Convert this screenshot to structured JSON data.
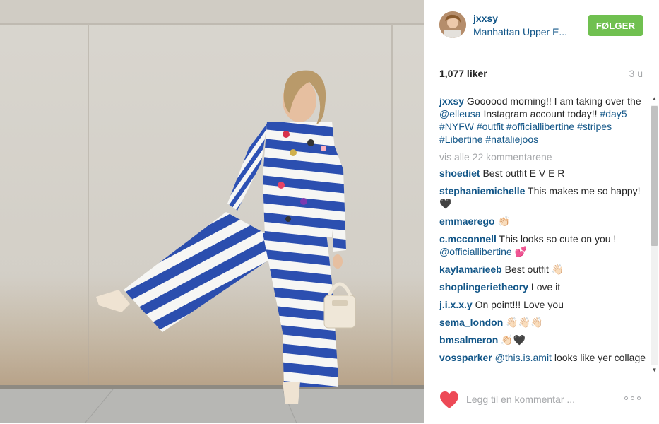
{
  "post": {
    "username": "jxxsy",
    "location": "Manhattan Upper E...",
    "follow_label": "FØLGER",
    "likes": "1,077 liker",
    "age": "3 u",
    "caption": {
      "user": "jxxsy",
      "text_1": " Goooood morning!! I am taking over the ",
      "mention": "@elleusa",
      "text_2": " Instagram account today!! ",
      "tags": [
        "#day5",
        "#NYFW",
        "#outfit",
        "#officiallibertine",
        "#stripes",
        "#Libertine",
        "#nataliejoos"
      ]
    },
    "view_all": "vis alle 22 kommentarene",
    "comments": [
      {
        "user": "shoediet",
        "text": " Best outfit E V E R"
      },
      {
        "user": "stephaniemichelle",
        "text": " This makes me so happy! 🖤"
      },
      {
        "user": "emmaerego",
        "text": " 👏🏻"
      },
      {
        "user": "c.mcconnell",
        "text": " This looks so cute on you ! ",
        "mention": "@officiallibertine",
        "tail": " 💕"
      },
      {
        "user": "kaylamarieeb",
        "text": " Best outfit 👋🏻"
      },
      {
        "user": "shoplingerietheory",
        "text": " Love it"
      },
      {
        "user": "j.i.x.x.y",
        "text": " On point!!! Love you"
      },
      {
        "user": "sema_london",
        "text": " 👋🏻👋🏻👋🏻"
      },
      {
        "user": "bmsalmeron",
        "text": " 👏🏻🖤"
      },
      {
        "user": "vossparker",
        "text": " ",
        "mention": "@this.is.amit",
        "tail": " looks like yer collage"
      }
    ],
    "comment_placeholder": "Legg til en kommentar ...",
    "colors": {
      "follow_green": "#70c050",
      "link_blue": "#125688",
      "heart_red": "#ed4956",
      "muted": "#a5a7aa"
    },
    "icons": [
      "heart-icon",
      "more-options-icon"
    ]
  }
}
